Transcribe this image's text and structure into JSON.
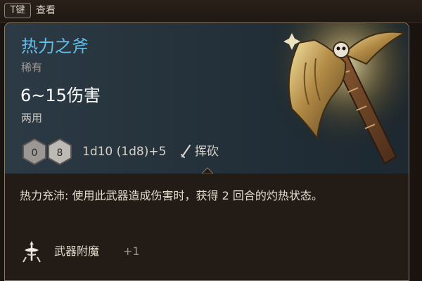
{
  "key_hint": {
    "key": "T键",
    "label": "查看"
  },
  "item": {
    "name": "热力之斧",
    "rarity": "稀有",
    "damage": "6~15伤害",
    "handedness": "两用",
    "dice_numbers": [
      "0",
      "8"
    ],
    "damage_dice": "1d10 (1d8)+5",
    "attack_type": "挥砍",
    "passive": "热力充沛: 使用此武器造成伤害时，获得 2 回合的灼热状态。",
    "enchantment_label": "武器附魔",
    "enchantment_value": "+1"
  },
  "colors": {
    "name": "#62bde8",
    "header_bg": "#2c3a45",
    "body_bg": "#221b16",
    "border": "#8a7b66"
  },
  "icons": {
    "weapon": "axe-icon",
    "dice": "dice-icon",
    "attack": "slash-icon",
    "enchant": "weapon-enchant-icon"
  }
}
